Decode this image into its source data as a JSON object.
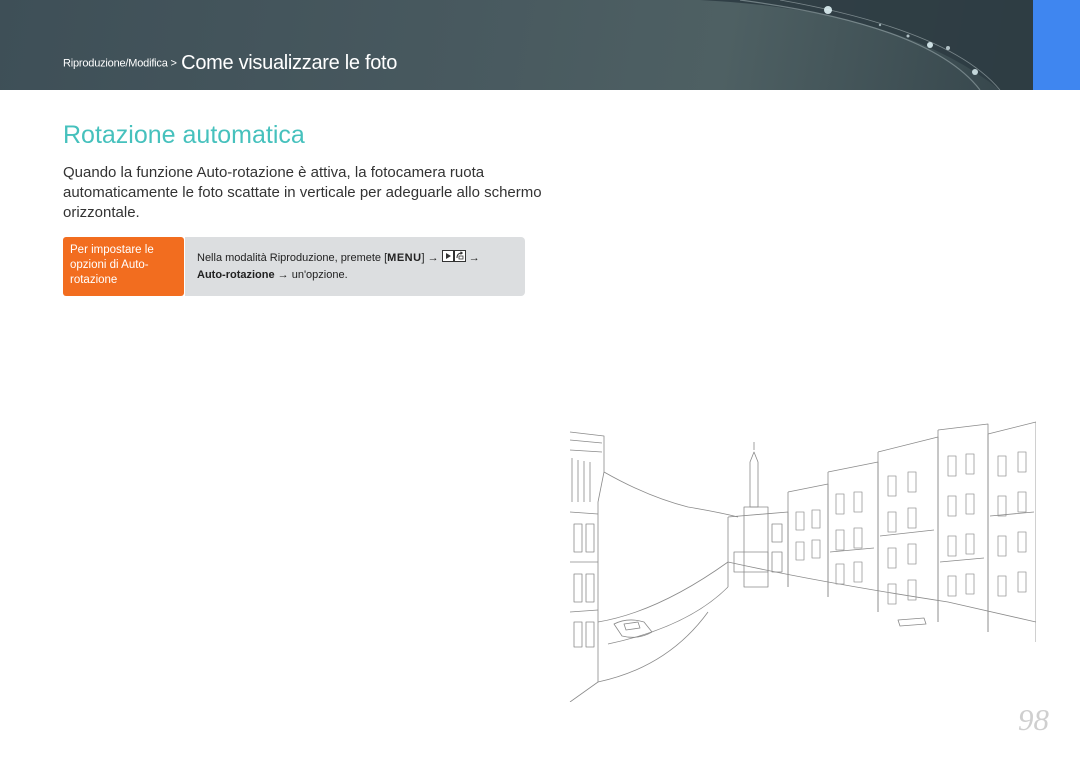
{
  "header": {
    "breadcrumb_section": "Riproduzione/Modifica >",
    "breadcrumb_page": "Come visualizzare le foto",
    "colors": {
      "background": "#46575d",
      "tab": "#3f86f0"
    }
  },
  "section": {
    "title": "Rotazione automatica",
    "title_color": "#46c1bd",
    "intro": "Quando la funzione Auto-rotazione è attiva, la fotocamera ruota automaticamente le foto scattate in verticale per adeguarle allo schermo orizzontale."
  },
  "howto": {
    "label": "Per impostare le opzioni di Auto-rotazione",
    "label_color": "#f26d1f",
    "step_prefix": "Nella modalità Riproduzione, premete [",
    "menu_key": "MENU",
    "step_after_key": "] →",
    "arrow_after_icons": "→",
    "setting": "Auto-rotazione",
    "step_suffix": " → un'opzione.",
    "icons": [
      "play-icon",
      "rotate-settings-icon"
    ]
  },
  "illustration": {
    "icon": "city-canal-sketch"
  },
  "page_number": "98"
}
